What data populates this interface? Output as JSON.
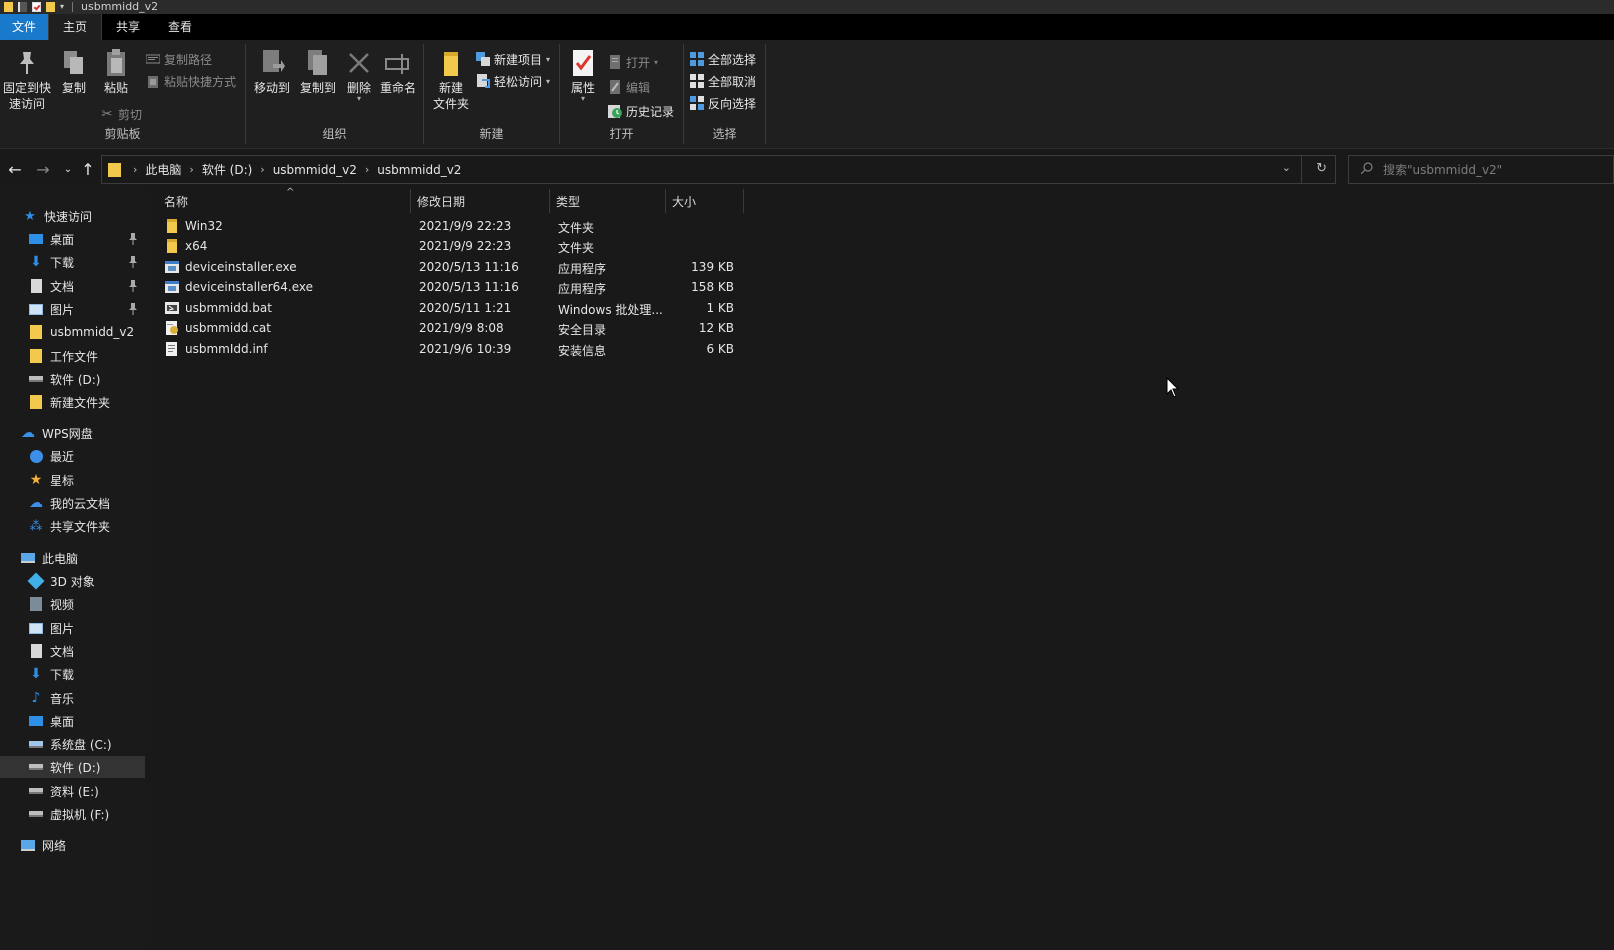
{
  "window": {
    "title": "usbmmidd_v2"
  },
  "tabs": [
    "文件",
    "主页",
    "共享",
    "查看"
  ],
  "ribbon": {
    "clipboard": {
      "pin_label": "固定到快\n速访问",
      "copy_label": "复制",
      "paste_label": "粘贴",
      "copy_path_label": "复制路径",
      "paste_shortcut_label": "粘贴快捷方式",
      "cut_label": "剪切",
      "group_label": "剪贴板"
    },
    "organize": {
      "move_to_label": "移动到",
      "copy_to_label": "复制到",
      "delete_label": "删除",
      "rename_label": "重命名",
      "group_label": "组织"
    },
    "new": {
      "new_folder_label": "新建\n文件夹",
      "new_item_label": "新建项目",
      "easy_access_label": "轻松访问",
      "group_label": "新建"
    },
    "open": {
      "properties_label": "属性",
      "open_label": "打开",
      "edit_label": "编辑",
      "history_label": "历史记录",
      "group_label": "打开"
    },
    "select": {
      "select_all_label": "全部选择",
      "select_none_label": "全部取消",
      "invert_label": "反向选择",
      "group_label": "选择"
    }
  },
  "address": {
    "breadcrumbs": [
      "此电脑",
      "软件 (D:)",
      "usbmmidd_v2",
      "usbmmidd_v2"
    ],
    "search_placeholder": "搜索\"usbmmidd_v2\""
  },
  "nav": {
    "quick_access": "快速访问",
    "quick_items": [
      "桌面",
      "下载",
      "文档",
      "图片",
      "usbmmidd_v2",
      "工作文件",
      "软件 (D:)",
      "新建文件夹"
    ],
    "wps": "WPS网盘",
    "wps_items": [
      "最近",
      "星标",
      "我的云文档",
      "共享文件夹"
    ],
    "this_pc": "此电脑",
    "pc_items": [
      "3D 对象",
      "视频",
      "图片",
      "文档",
      "下载",
      "音乐",
      "桌面",
      "系统盘 (C:)",
      "软件 (D:)",
      "资料 (E:)",
      "虚拟机 (F:)"
    ],
    "network": "网络"
  },
  "columns": {
    "name": "名称",
    "date": "修改日期",
    "type": "类型",
    "size": "大小"
  },
  "files": [
    {
      "name": "Win32",
      "date": "2021/9/9 22:23",
      "type": "文件夹",
      "size": "",
      "icon": "folder-icon"
    },
    {
      "name": "x64",
      "date": "2021/9/9 22:23",
      "type": "文件夹",
      "size": "",
      "icon": "folder-icon"
    },
    {
      "name": "deviceinstaller.exe",
      "date": "2020/5/13 11:16",
      "type": "应用程序",
      "size": "139 KB",
      "icon": "exe-icon"
    },
    {
      "name": "deviceinstaller64.exe",
      "date": "2020/5/13 11:16",
      "type": "应用程序",
      "size": "158 KB",
      "icon": "exe-icon"
    },
    {
      "name": "usbmmidd.bat",
      "date": "2020/5/11 1:21",
      "type": "Windows 批处理...",
      "size": "1 KB",
      "icon": "bat-icon"
    },
    {
      "name": "usbmmidd.cat",
      "date": "2021/9/9 8:08",
      "type": "安全目录",
      "size": "12 KB",
      "icon": "cat-icon"
    },
    {
      "name": "usbmmIdd.inf",
      "date": "2021/9/6 10:39",
      "type": "安装信息",
      "size": "6 KB",
      "icon": "inf-icon"
    }
  ],
  "colors": {
    "accent": "#1979ca",
    "folder": "#f2c94c",
    "bg": "#191919"
  }
}
